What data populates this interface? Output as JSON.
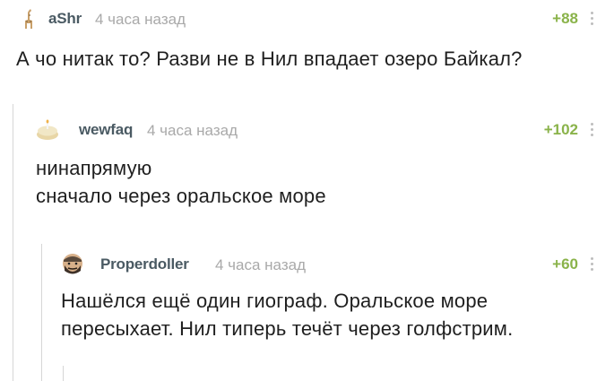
{
  "comments": [
    {
      "author": "aShr",
      "time": "4 часа назад",
      "rating": "+88",
      "text": [
        "А чо нитак то? Разви не в Нил впадает озеро Байкал?"
      ]
    },
    {
      "author": "wewfaq",
      "time": "4 часа назад",
      "rating": "+102",
      "text": [
        "нинапрямую",
        "сначало через оральское море"
      ]
    },
    {
      "author": "Properdoller",
      "time": "4 часа назад",
      "rating": "+60",
      "text": [
        "Нашёлся ещё один гиограф. Оральское море",
        "пересыхает. Нил типерь течёт через голфстрим."
      ]
    }
  ],
  "icons": {
    "avatar_1": "giraffe-avatar-icon",
    "avatar_2": "cake-avatar-icon",
    "avatar_3": "bearded-man-avatar-icon",
    "more": "vertical-dots-icon"
  },
  "colors": {
    "author": "#4a5a63",
    "time": "#a9a9a9",
    "rating": "#8ab34a",
    "text": "#1f1f1f",
    "branch_line": "#d6d6d6"
  }
}
